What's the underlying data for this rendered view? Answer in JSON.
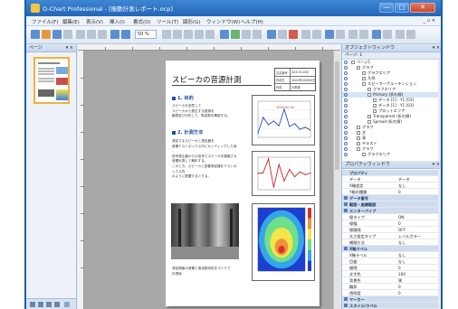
{
  "window": {
    "title": "O-Chart Professional - [振動計測レポート.ocp]",
    "min_label": "—",
    "max_label": "□",
    "close_label": "✕"
  },
  "menu": {
    "items": [
      "ファイル(F)",
      "編集(E)",
      "表示(V)",
      "挿入(I)",
      "書式(O)",
      "ツール(T)",
      "図形(G)",
      "ウィンドウ(W)",
      "ヘルプ(H)"
    ],
    "mdi_controls": "_ ▫ ×"
  },
  "toolbar": {
    "zoom_value": "50 %",
    "icons": [
      "new-icon",
      "open-icon",
      "save-icon",
      "print-icon",
      "cut-icon",
      "copy-icon",
      "paste-icon",
      "undo-icon",
      "redo-icon",
      "pointer-icon",
      "text-icon",
      "line-icon",
      "rect-icon",
      "ellipse-icon",
      "chart-icon",
      "image-icon",
      "align-icon",
      "grid-icon"
    ]
  },
  "left_pane": {
    "header": "ページ"
  },
  "document": {
    "title": "スピーカの音源計測",
    "info_table": [
      [
        "文書番号",
        "XXX-00-000"
      ],
      [
        "作成日",
        "20XX年XX月XX日"
      ],
      [
        "作成",
        "計測課"
      ]
    ],
    "sections": [
      {
        "heading": "1. 目的",
        "body": "スピーカを用意して\nスピーカから発生する音源を\n観測並び分析して、周波数を確認する。"
      },
      {
        "heading": "2. 計測方法",
        "body": "測定するスピーカと測定器を\n音響テストボックス内にセッティングした後\n、\n信号発生器からの信号でスピーカを駆動させ\n音響計測して解析する。\nこのとき、スピーカと音響測定器をテストボックス内\nのように配置するとする。"
      }
    ],
    "caption": "測定場面の音響と周波数特性をマイクで\n計測後"
  },
  "chart_data": [
    {
      "type": "line",
      "title": "",
      "xlabel": "",
      "ylabel": "",
      "x": [
        0,
        20,
        40,
        60,
        80,
        100,
        120,
        140,
        160,
        180,
        200
      ],
      "series": [
        {
          "values": [
            0.12,
            0.55,
            0.35,
            0.45,
            0.32,
            0.78,
            0.3,
            0.38,
            0.22,
            0.28,
            0.2
          ]
        }
      ],
      "annotations": [
        "1000.00 Hz"
      ]
    },
    {
      "type": "line",
      "title": "",
      "xlabel": "",
      "ylabel": "",
      "x": [
        0,
        10,
        20,
        30,
        40,
        50,
        60,
        70,
        80,
        90,
        100
      ],
      "series": [
        {
          "values": [
            0,
            0.05,
            0.9,
            -0.85,
            0.55,
            -0.45,
            0.25,
            -0.2,
            0.1,
            -0.08,
            0.03
          ]
        }
      ]
    },
    {
      "type": "heatmap",
      "title": "",
      "colormap": [
        "#1b3fd1",
        "#35a6e8",
        "#6fe08a",
        "#f2e64a",
        "#f0913a",
        "#d8322a"
      ]
    }
  ],
  "tree_pane": {
    "header": "オブジェクトウィンドウ",
    "tools": "ページ: 1",
    "rows": [
      {
        "indent": 0,
        "label": "ページ1"
      },
      {
        "indent": 1,
        "label": "グラフ"
      },
      {
        "indent": 2,
        "label": "グラフエリア"
      },
      {
        "indent": 2,
        "label": "凡例"
      },
      {
        "indent": 2,
        "label": "スピーカーブルーテンション"
      },
      {
        "indent": 3,
        "label": "グラフエリア"
      },
      {
        "indent": 3,
        "label": "Primary (折れ線)"
      },
      {
        "indent": 4,
        "label": "データ [1] - Y1 [03]"
      },
      {
        "indent": 4,
        "label": "データ [1] - Y1 [03]"
      },
      {
        "indent": 4,
        "label": "プロットエリア"
      },
      {
        "indent": 3,
        "label": "Transparent (折れ線)"
      },
      {
        "indent": 3,
        "label": "Spread (折れ線)"
      },
      {
        "indent": 1,
        "label": "グラフ"
      },
      {
        "indent": 1,
        "label": "文"
      },
      {
        "indent": 1,
        "label": "表"
      },
      {
        "indent": 1,
        "label": "テキスト"
      },
      {
        "indent": 1,
        "label": "グラフ"
      },
      {
        "indent": 2,
        "label": "グラフエリア"
      }
    ]
  },
  "props_pane": {
    "header": "プロパティウィンドウ",
    "subheader": "プロパティ",
    "rows": [
      {
        "cat": false,
        "name": "データ",
        "value": "データ"
      },
      {
        "cat": false,
        "name": "X軸設定",
        "value": "なし"
      },
      {
        "cat": false,
        "name": "Y軸の種類",
        "value": "0"
      },
      {
        "cat": true,
        "name": "データ番号",
        "value": ""
      },
      {
        "cat": true,
        "name": "範囲・座標範囲",
        "value": ""
      },
      {
        "cat": true,
        "name": "エンターパイプ",
        "value": ""
      },
      {
        "cat": false,
        "name": "線タイプ",
        "value": "ON"
      },
      {
        "cat": false,
        "name": "線幅",
        "value": "0"
      },
      {
        "cat": false,
        "name": "線間隔",
        "value": "OFF"
      },
      {
        "cat": false,
        "name": "太さ設定タイプ",
        "value": "レベルカラー"
      },
      {
        "cat": false,
        "name": "補間方法",
        "value": "なし"
      },
      {
        "cat": true,
        "name": "X軸ラベル",
        "value": ""
      },
      {
        "cat": false,
        "name": "X軸ラベル",
        "value": "なし"
      },
      {
        "cat": false,
        "name": "目盛",
        "value": "なし"
      },
      {
        "cat": false,
        "name": "間隔",
        "value": "0"
      },
      {
        "cat": false,
        "name": "文字色",
        "value": "100"
      },
      {
        "cat": false,
        "name": "背景色",
        "value": "黒"
      },
      {
        "cat": false,
        "name": "輪郭",
        "value": "0"
      },
      {
        "cat": false,
        "name": "透明度",
        "value": "0"
      },
      {
        "cat": true,
        "name": "マーカー",
        "value": ""
      },
      {
        "cat": true,
        "name": "スタイル/ラベル",
        "value": ""
      }
    ]
  },
  "colors": {
    "title_bar": "#2366b8",
    "accent": "#1f4fa3",
    "selection": "#f0b23c"
  }
}
